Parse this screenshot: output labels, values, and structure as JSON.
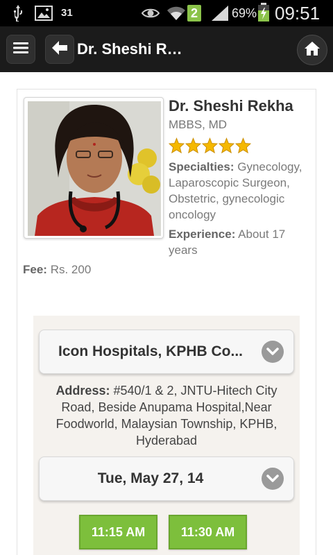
{
  "status_bar": {
    "notification_number": "31",
    "notification_badge": "2",
    "battery_percent": "69%",
    "time": "09:51",
    "icons": [
      "usb-icon",
      "image-icon",
      "eye-icon",
      "wifi-icon",
      "signal-icon",
      "battery-icon"
    ]
  },
  "action_bar": {
    "title": "Dr. Sheshi R…",
    "icons": [
      "menu-icon",
      "back-arrow-icon",
      "home-icon"
    ]
  },
  "doctor": {
    "name": "Dr. Sheshi Rekha",
    "degree": "MBBS, MD",
    "rating_stars": 5,
    "specialties_label": "Specialties:",
    "specialties_value": " Gynecology, Laparoscopic Surgeon, Obstetric, gynecologic oncology",
    "experience_label": "Experience:",
    "experience_value": " About 17 years",
    "fee_label": "Fee:",
    "fee_value": " Rs. 200"
  },
  "booking": {
    "hospital": "Icon Hospitals, KPHB Co...",
    "address_label": "Address:",
    "address_value": " #540/1 & 2, JNTU-Hitech City Road, Beside Anupama Hospital,Near Foodworld, Malaysian Township, KPHB, Hyderabad",
    "date": "Tue, May 27, 14",
    "slots": [
      "11:15 AM",
      "11:30 AM"
    ]
  },
  "colors": {
    "slot_green": "#7dbf3c",
    "star_gold": "#f5b800",
    "action_bar": "#1b1b1b"
  }
}
